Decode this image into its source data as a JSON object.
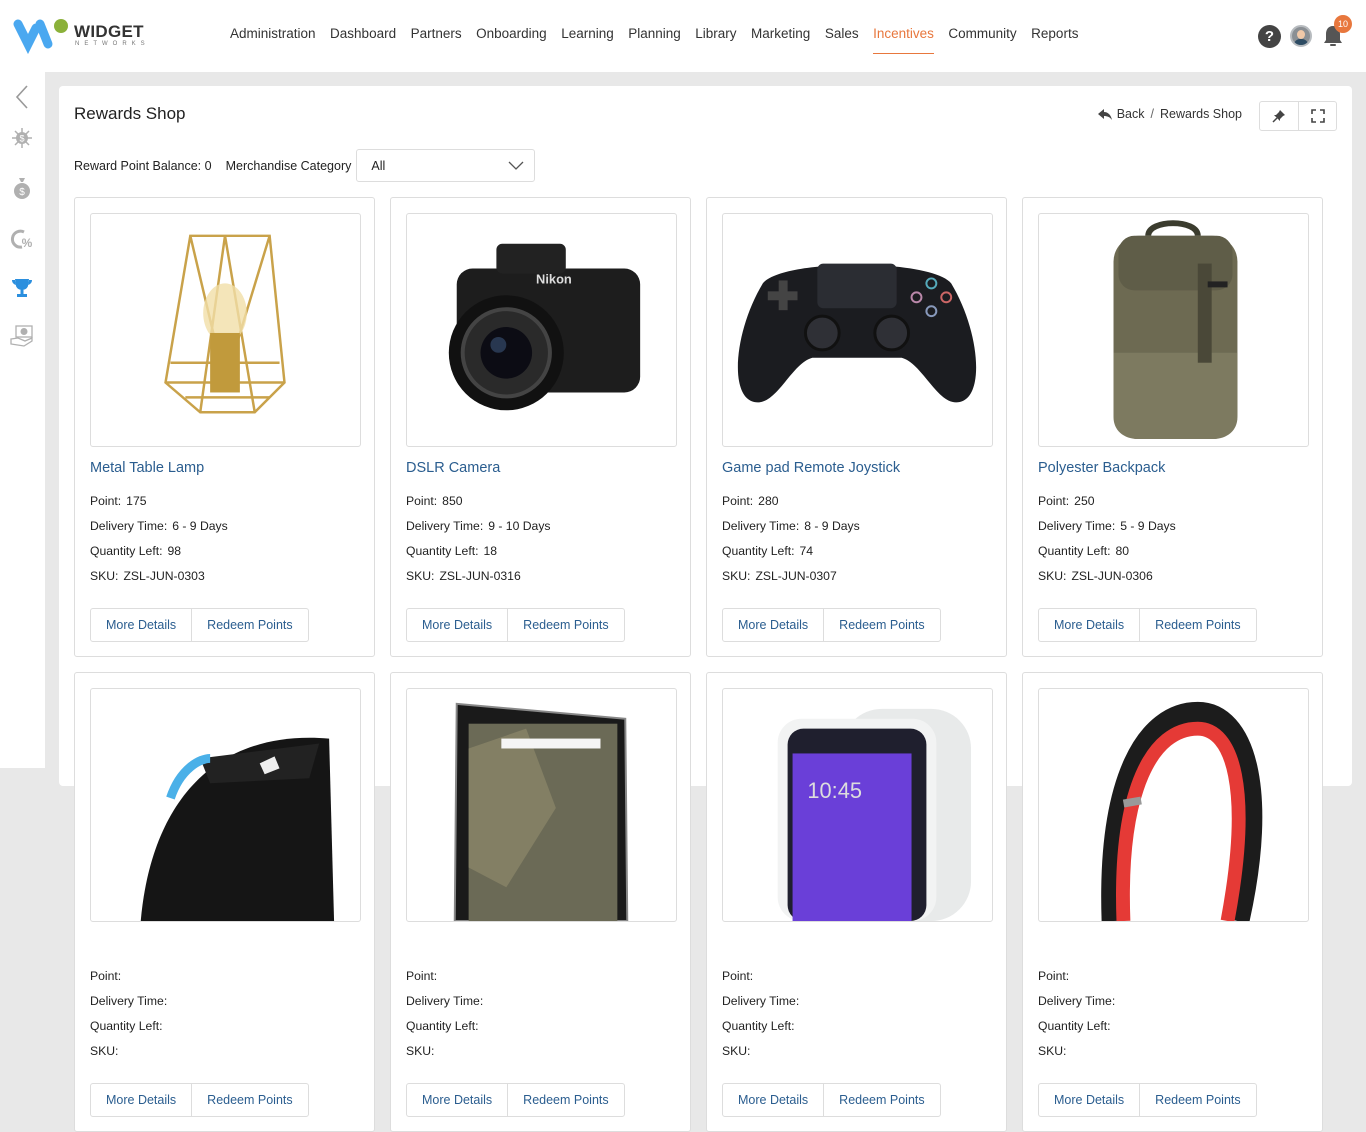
{
  "brand": {
    "name": "WIDGET",
    "sub": "NETWORKS",
    "colors": {
      "blue": "#4aa8f0",
      "green": "#8bb13a"
    }
  },
  "nav": {
    "items": [
      {
        "label": "Administration"
      },
      {
        "label": "Dashboard"
      },
      {
        "label": "Partners"
      },
      {
        "label": "Onboarding"
      },
      {
        "label": "Learning"
      },
      {
        "label": "Planning"
      },
      {
        "label": "Library"
      },
      {
        "label": "Marketing"
      },
      {
        "label": "Sales"
      },
      {
        "label": "Incentives",
        "active": true
      },
      {
        "label": "Community"
      },
      {
        "label": "Reports"
      }
    ],
    "accent_color": "#e8773d",
    "help_label": "?",
    "notification_count": "10"
  },
  "sidebar": {
    "items": [
      {
        "icon": "collapse-chevron-icon"
      },
      {
        "icon": "dollar-network-icon"
      },
      {
        "icon": "money-bag-icon"
      },
      {
        "icon": "percent-cycle-icon"
      },
      {
        "icon": "trophy-icon",
        "active": true
      },
      {
        "icon": "hand-money-icon"
      }
    ]
  },
  "page": {
    "title": "Rewards Shop",
    "breadcrumb": {
      "back": "Back",
      "separator": "/",
      "current": "Rewards Shop"
    },
    "balance_label": "Reward Point Balance: 0",
    "category_label": "Merchandise Category",
    "category_value": "All"
  },
  "labels": {
    "point": "Point:",
    "delivery": "Delivery Time:",
    "quantity": "Quantity Left:",
    "sku": "SKU:",
    "more_details": "More Details",
    "redeem": "Redeem Points"
  },
  "products": [
    {
      "name": "Metal Table Lamp",
      "point": "175",
      "delivery": "6 - 9 Days",
      "quantity": "98",
      "sku": "ZSL-JUN-0303",
      "image": "lamp"
    },
    {
      "name": "DSLR Camera",
      "point": "850",
      "delivery": "9 - 10 Days",
      "quantity": "18",
      "sku": "ZSL-JUN-0316",
      "image": "camera"
    },
    {
      "name": "Game pad Remote Joystick",
      "point": "280",
      "delivery": "8 - 9 Days",
      "quantity": "74",
      "sku": "ZSL-JUN-0307",
      "image": "gamepad"
    },
    {
      "name": "Polyester Backpack",
      "point": "250",
      "delivery": "5 - 9 Days",
      "quantity": "80",
      "sku": "ZSL-JUN-0306",
      "image": "backpack"
    },
    {
      "image": "mouse"
    },
    {
      "image": "tablet"
    },
    {
      "image": "smartwatch"
    },
    {
      "image": "headphones"
    }
  ]
}
